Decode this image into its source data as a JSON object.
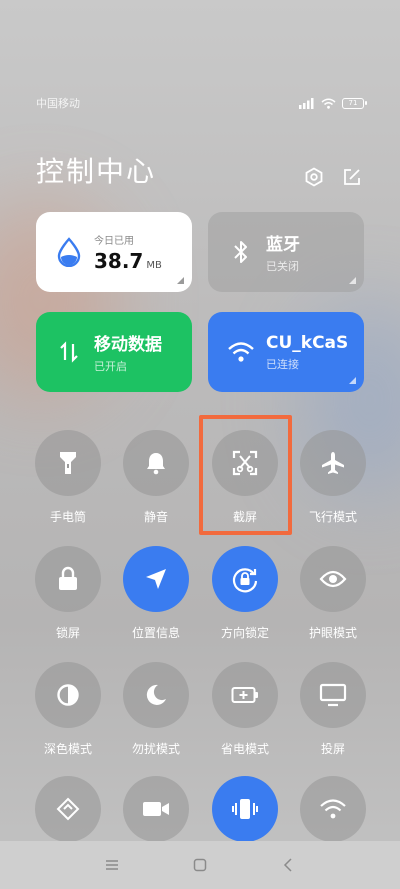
{
  "status_bar": {
    "carrier": "中国移动",
    "battery_level": "71"
  },
  "header": {
    "title": "控制中心"
  },
  "cards": {
    "data_usage": {
      "label": "今日已用",
      "value": "38.7",
      "unit": "MB"
    },
    "bluetooth": {
      "title": "蓝牙",
      "status": "已关闭"
    },
    "mobile_data": {
      "title": "移动数据",
      "status": "已开启"
    },
    "wifi": {
      "title": "CU_kCaS",
      "status": "已连接"
    }
  },
  "tiles": [
    {
      "label": "手电筒",
      "icon": "flashlight-icon",
      "active": false
    },
    {
      "label": "静音",
      "icon": "bell-icon",
      "active": false
    },
    {
      "label": "截屏",
      "icon": "screenshot-icon",
      "active": false
    },
    {
      "label": "飞行模式",
      "icon": "airplane-icon",
      "active": false
    },
    {
      "label": "锁屏",
      "icon": "lock-icon",
      "active": false
    },
    {
      "label": "位置信息",
      "icon": "location-icon",
      "active": true
    },
    {
      "label": "方向锁定",
      "icon": "rotation-lock-icon",
      "active": true
    },
    {
      "label": "护眼模式",
      "icon": "eye-icon",
      "active": false
    },
    {
      "label": "深色模式",
      "icon": "dark-mode-icon",
      "active": false
    },
    {
      "label": "勿扰模式",
      "icon": "moon-icon",
      "active": false
    },
    {
      "label": "省电模式",
      "icon": "battery-saver-icon",
      "active": false
    },
    {
      "label": "投屏",
      "icon": "cast-icon",
      "active": false
    },
    {
      "label": "",
      "icon": "link-icon",
      "active": false
    },
    {
      "label": "",
      "icon": "video-icon",
      "active": false
    },
    {
      "label": "",
      "icon": "vibrate-icon",
      "active": true
    },
    {
      "label": "",
      "icon": "wifi-share-icon",
      "active": false
    }
  ],
  "colors": {
    "accent_blue": "#3a7cf0",
    "accent_green": "#1dc263",
    "highlight": "#f26a3d"
  }
}
